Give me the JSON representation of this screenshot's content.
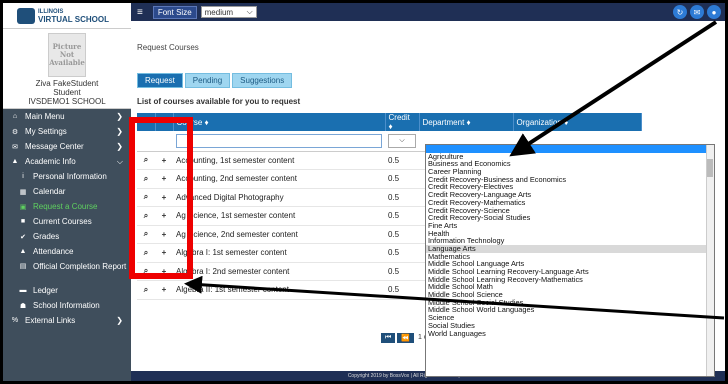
{
  "logo": {
    "line1": "ILLINOIS",
    "line2": "VIRTUAL SCHOOL"
  },
  "profile": {
    "avatar_text": "Picture Not Available",
    "name": "Ziva FakeStudent",
    "role": "Student",
    "school": "IVSDEMO1 SCHOOL"
  },
  "sidebar": {
    "items": [
      {
        "label": "Main Menu",
        "icon": "home-icon",
        "glyph": "⌂",
        "arrow": "❯"
      },
      {
        "label": "My Settings",
        "icon": "gear-icon",
        "glyph": "⚙",
        "arrow": "❯"
      },
      {
        "label": "Message Center",
        "icon": "chat-icon",
        "glyph": "✉",
        "arrow": "❯"
      },
      {
        "label": "Academic Info",
        "icon": "graduation-cap-icon",
        "glyph": "▲",
        "arrow": "⌵"
      },
      {
        "label": "Personal Information",
        "icon": "info-icon",
        "glyph": "i"
      },
      {
        "label": "Calendar",
        "icon": "calendar-icon",
        "glyph": "▦"
      },
      {
        "label": "Request a Course",
        "icon": "plus-square-icon",
        "glyph": "▣"
      },
      {
        "label": "Current Courses",
        "icon": "square-icon",
        "glyph": "■"
      },
      {
        "label": "Grades",
        "icon": "check-icon",
        "glyph": "✔"
      },
      {
        "label": "Attendance",
        "icon": "bell-icon",
        "glyph": "▲"
      },
      {
        "label": "Official Completion Report",
        "icon": "document-icon",
        "glyph": "▤"
      },
      {
        "label": "Ledger",
        "icon": "ledger-icon",
        "glyph": "▬"
      },
      {
        "label": "School Information",
        "icon": "building-icon",
        "glyph": "☗"
      },
      {
        "label": "External Links",
        "icon": "link-icon",
        "glyph": "%",
        "arrow": "❯"
      }
    ]
  },
  "topbar": {
    "menu_glyph": "≡",
    "font_size_label": "Font Size",
    "font_size_value": "medium",
    "caret": "⌵",
    "icons": [
      {
        "name": "refresh-icon",
        "glyph": "↻"
      },
      {
        "name": "mail-icon",
        "glyph": "✉"
      },
      {
        "name": "user-icon",
        "glyph": "●"
      }
    ]
  },
  "main": {
    "page_title": "Request Courses",
    "tabs": [
      "Request",
      "Pending",
      "Suggestions"
    ],
    "list_heading": "List of courses available for you to request",
    "columns": [
      "",
      "",
      "Course ♦",
      "Credit ♦",
      "Department ♦",
      "Organization ♦"
    ],
    "search_glyph": "⌕",
    "add_glyph": "+",
    "rows": [
      {
        "course": "Accounting, 1st semester content",
        "credit": "0.5"
      },
      {
        "course": "Accounting, 2nd semester content",
        "credit": "0.5"
      },
      {
        "course": "Advanced Digital Photography",
        "credit": "0.5"
      },
      {
        "course": "Ag Science, 1st semester content",
        "credit": "0.5"
      },
      {
        "course": "Ag Science, 2nd semester content",
        "credit": "0.5"
      },
      {
        "course": "Algebra I: 1st semester content",
        "credit": "0.5"
      },
      {
        "course": "Algebra I: 2nd semester content",
        "credit": "0.5"
      },
      {
        "course": "Algebra II: 1st semester content",
        "credit": "0.5"
      }
    ],
    "pager": {
      "first": "⏮",
      "prev": "⏪",
      "page": "1 of"
    }
  },
  "department_options": [
    "",
    "Agriculture",
    "Business and Economics",
    "Career Planning",
    "Credit Recovery-Business and Economics",
    "Credit Recovery-Electives",
    "Credit Recovery-Language Arts",
    "Credit Recovery-Mathematics",
    "Credit Recovery-Science",
    "Credit Recovery-Social Studies",
    "Fine Arts",
    "Health",
    "Information Technology",
    "Language Arts",
    "Mathematics",
    "Middle School Language Arts",
    "Middle School Learning Recovery-Language Arts",
    "Middle School Learning Recovery-Mathematics",
    "Middle School Math",
    "Middle School Science",
    "Middle School Social Studies",
    "Middle School World Languages",
    "Science",
    "Social Studies",
    "World Languages"
  ],
  "highlighted_option": "Language Arts",
  "footer": "Copyright 2019 by BossVox | All Rights Reserved | Mandro SIS - The Na",
  "colors": {
    "sidebar": "#3f4e5c",
    "topbar": "#1f2f55",
    "accent": "#1a6fb0",
    "annotation": "#e00000"
  }
}
